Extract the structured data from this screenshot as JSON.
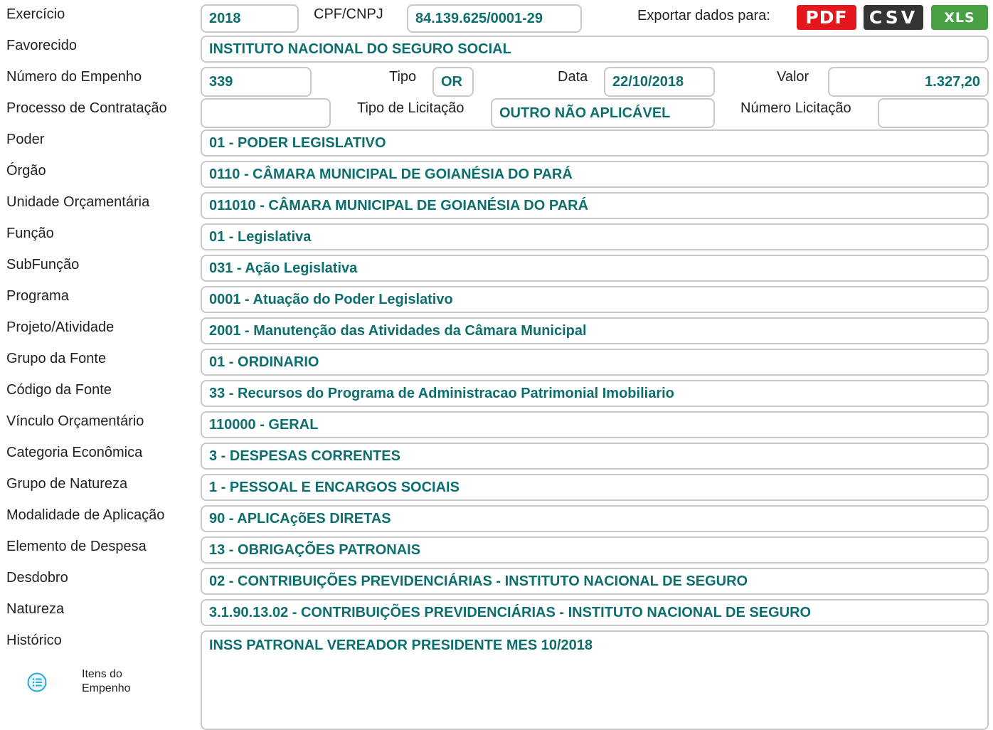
{
  "header": {
    "exercicio_label": "Exercício",
    "exercicio_value": "2018",
    "cpf_label": "CPF/CNPJ",
    "cpf_value": "84.139.625/0001-29",
    "export_label": "Exportar dados para:",
    "export_pdf": "PDF",
    "export_csv": "CSV",
    "export_xls": "XLS",
    "colors": {
      "pdf": "#e4171c",
      "csv": "#333333",
      "xls": "#48a043",
      "value_text": "#0e6e6e",
      "border": "#c8c8c8"
    }
  },
  "fields": {
    "favorecido_label": "Favorecido",
    "favorecido_value": "INSTITUTO NACIONAL DO SEGURO SOCIAL",
    "empenho_label": "Número do Empenho",
    "empenho_value": "339",
    "tipo_label": "Tipo",
    "tipo_value": "OR",
    "data_label": "Data",
    "data_value": "22/10/2018",
    "valor_label": "Valor",
    "valor_value": "1.327,20",
    "processo_label": "Processo de Contratação",
    "processo_value": "",
    "tipo_licitacao_label": "Tipo de Licitação",
    "tipo_licitacao_value": "OUTRO NÃO APLICÁVEL",
    "numero_licitacao_label": "Número Licitação",
    "numero_licitacao_value": ""
  },
  "rows": [
    {
      "label": "Poder",
      "value": "01 - PODER LEGISLATIVO"
    },
    {
      "label": "Órgão",
      "value": "0110 - CÂMARA MUNICIPAL DE GOIANÉSIA DO PARÁ"
    },
    {
      "label": "Unidade Orçamentária",
      "value": "011010 - CÂMARA MUNICIPAL DE GOIANÉSIA DO PARÁ"
    },
    {
      "label": "Função",
      "value": "01 - Legislativa"
    },
    {
      "label": "SubFunção",
      "value": "031 - Ação Legislativa"
    },
    {
      "label": "Programa",
      "value": "0001 - Atuação do Poder Legislativo"
    },
    {
      "label": "Projeto/Atividade",
      "value": "2001 - Manutenção das Atividades da Câmara Municipal"
    },
    {
      "label": "Grupo da Fonte",
      "value": "01 - ORDINARIO"
    },
    {
      "label": "Código da Fonte",
      "value": "33 - Recursos do Programa de Administracao Patrimonial Imobiliario"
    },
    {
      "label": "Vínculo Orçamentário",
      "value": "110000 - GERAL"
    },
    {
      "label": "Categoria Econômica",
      "value": "3 - DESPESAS CORRENTES"
    },
    {
      "label": "Grupo de Natureza",
      "value": "1 - PESSOAL E ENCARGOS SOCIAIS"
    },
    {
      "label": "Modalidade de Aplicação",
      "value": "90 - APLICAçõES DIRETAS"
    },
    {
      "label": "Elemento de Despesa",
      "value": "13 - OBRIGAÇÕES PATRONAIS"
    },
    {
      "label": "Desdobro",
      "value": "02 - CONTRIBUIÇÕES PREVIDENCIÁRIAS - INSTITUTO NACIONAL DE SEGURO"
    },
    {
      "label": "Natureza",
      "value": "3.1.90.13.02 - CONTRIBUIÇÕES PREVIDENCIÁRIAS - INSTITUTO NACIONAL DE SEGURO"
    }
  ],
  "historico": {
    "label": "Histórico",
    "value": "INSS PATRONAL VEREADOR PRESIDENTE MES 10/2018"
  },
  "itens": {
    "icon": "list-icon",
    "label_line1": "Itens do",
    "label_line2": "Empenho"
  }
}
